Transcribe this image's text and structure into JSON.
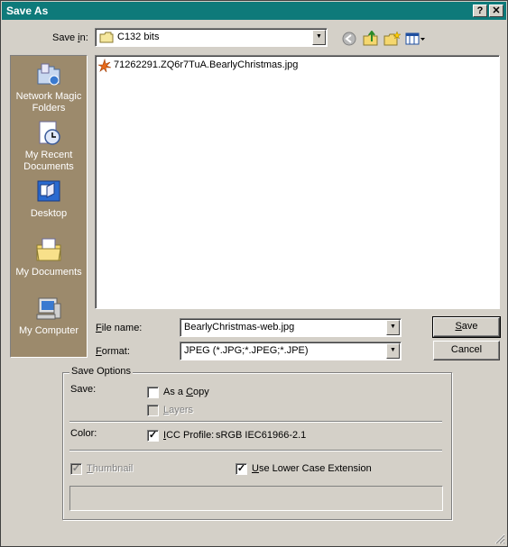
{
  "window": {
    "title": "Save As",
    "help_btn": "?",
    "close_btn": "✕"
  },
  "save_in": {
    "label_pre": "Save ",
    "label_ul": "i",
    "label_post": "n:",
    "value": "C132 bits"
  },
  "toolbar": {
    "icons": [
      "back-icon",
      "up-folder-icon",
      "new-folder-icon",
      "view-menu-icon"
    ]
  },
  "places": [
    {
      "label1": "Network Magic",
      "label2": "Folders",
      "icon": "network-magic-folders-icon"
    },
    {
      "label1": "My Recent",
      "label2": "Documents",
      "icon": "recent-documents-icon"
    },
    {
      "label1": "Desktop",
      "label2": "",
      "icon": "desktop-icon"
    },
    {
      "label1": "My Documents",
      "label2": "",
      "icon": "my-documents-icon"
    },
    {
      "label1": "My Computer",
      "label2": "",
      "icon": "my-computer-icon"
    }
  ],
  "files": [
    {
      "name": "71262291.ZQ6r7TuA.BearlyChristmas.jpg",
      "icon": "jpg-file-icon"
    }
  ],
  "file_name": {
    "label_ul": "F",
    "label_post": "ile name:",
    "value": "BearlyChristmas-web.jpg"
  },
  "format": {
    "label_ul": "F",
    "label_post": "ormat:",
    "value": "JPEG (*.JPG;*.JPEG;*.JPE)"
  },
  "buttons": {
    "save_ul": "S",
    "save_post": "ave",
    "cancel": "Cancel"
  },
  "save_options": {
    "title": "Save Options",
    "save_label": "Save:",
    "as_copy": {
      "ul": "",
      "pre": "As a ",
      "ul2": "C",
      "post": "opy",
      "checked": false
    },
    "layers": {
      "ul": "L",
      "post": "ayers",
      "checked": false,
      "disabled": true
    },
    "color_label": "Color:",
    "icc": {
      "pre": "",
      "ul": "I",
      "post": "CC Profile:",
      "profile": "sRGB IEC61966-2.1",
      "checked": true
    },
    "thumbnail": {
      "ul": "T",
      "post": "humbnail",
      "checked": true,
      "disabled": true
    },
    "lower_case": {
      "ul": "U",
      "post": "se Lower Case Extension",
      "checked": true
    }
  },
  "colors": {
    "title_bar": "#0e7a7a",
    "places_bg": "#9c8a6c",
    "face": "#d4d0c8"
  }
}
